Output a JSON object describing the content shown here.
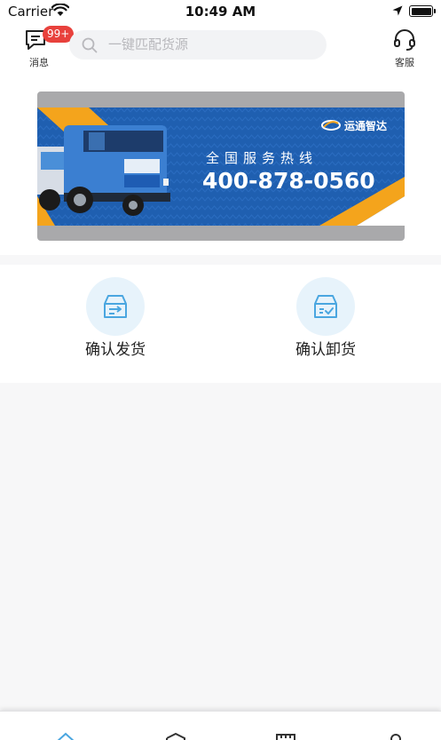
{
  "status_bar": {
    "carrier": "Carrier",
    "time": "10:49 AM"
  },
  "header": {
    "message": {
      "label": "消息",
      "badge": "99+"
    },
    "search": {
      "placeholder": "一键匹配货源"
    },
    "service": {
      "label": "客服"
    }
  },
  "banner": {
    "brand": "运通智达",
    "subtitle": "全国服务热线",
    "phone": "400-878-0560"
  },
  "actions": [
    {
      "label": "确认发货",
      "icon": "box-arrow-icon"
    },
    {
      "label": "确认卸货",
      "icon": "box-check-icon"
    }
  ],
  "tabbar": {
    "icons": [
      "home-icon",
      "cube-icon",
      "grid-icon",
      "user-icon"
    ],
    "active_color": "#4aa6e0"
  },
  "colors": {
    "accent": "#4aa6e0",
    "badge": "#e8413c",
    "banner_blue": "#1f5fb0",
    "banner_orange": "#f4a41c"
  }
}
